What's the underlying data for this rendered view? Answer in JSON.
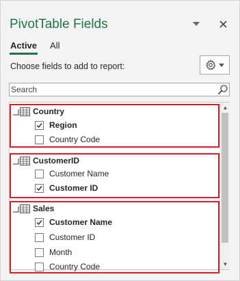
{
  "pane": {
    "title": "PivotTable Fields",
    "tabs": [
      {
        "label": "Active",
        "selected": true
      },
      {
        "label": "All",
        "selected": false
      }
    ],
    "hint": "Choose fields to add to report:",
    "search": {
      "placeholder": "Search",
      "value": ""
    },
    "accent_color": "#217346",
    "highlight_color": "#d81b2b",
    "groups": [
      {
        "label": "Country",
        "fields": [
          {
            "label": "Region",
            "checked": true
          },
          {
            "label": "Country Code",
            "checked": false
          }
        ]
      },
      {
        "label": "CustomerID",
        "fields": [
          {
            "label": "Customer Name",
            "checked": false
          },
          {
            "label": "Customer ID",
            "checked": true
          }
        ]
      },
      {
        "label": "Sales",
        "fields": [
          {
            "label": "Customer Name",
            "checked": true
          },
          {
            "label": "Customer ID",
            "checked": false
          },
          {
            "label": "Month",
            "checked": false
          },
          {
            "label": "Country Code",
            "checked": false
          }
        ]
      }
    ],
    "icons": {
      "dropdown": "chevron-down-icon",
      "close": "close-icon",
      "settings": "gear-icon",
      "search": "search-icon",
      "table": "table-icon"
    }
  }
}
